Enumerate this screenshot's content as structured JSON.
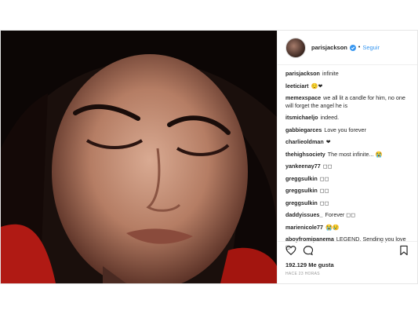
{
  "header": {
    "username": "parisjackson",
    "separator": "•",
    "follow_label": "Seguir"
  },
  "icons": {
    "verified": "verified-badge-icon",
    "like": "heart-icon",
    "comment": "comment-bubble-icon",
    "save": "bookmark-icon"
  },
  "colors": {
    "link": "#3897f0",
    "text": "#262626",
    "muted": "#999999"
  },
  "comments": [
    {
      "user": "parisjackson",
      "text": "infinite"
    },
    {
      "user": "leeticiart",
      "text": "😌❤"
    },
    {
      "user": "memexspace",
      "text": "we all lit a candle for him, no one will forget the angel he is"
    },
    {
      "user": "itsmichaeljo",
      "text": "indeed."
    },
    {
      "user": "gabbiegarces",
      "text": "Love you forever"
    },
    {
      "user": "charlieoldman",
      "text": "❤"
    },
    {
      "user": "thehighsociety",
      "text": "The most infinite... 😭"
    },
    {
      "user": "yankeenay77",
      "text": "◻◻"
    },
    {
      "user": "greggsulkin",
      "text": "◻◻"
    },
    {
      "user": "greggsulkin",
      "text": "◻◻"
    },
    {
      "user": "greggsulkin",
      "text": "◻◻"
    },
    {
      "user": "daddyissues_",
      "text": "Forever ◻◻"
    },
    {
      "user": "marienicole77",
      "text": "😭😢"
    },
    {
      "user": "aboyfromipanema",
      "text": "LEGEND. Sending you love ◻"
    }
  ],
  "likes_text": "192.129 Me gusta",
  "time_text": "HACE 23 HORAS"
}
